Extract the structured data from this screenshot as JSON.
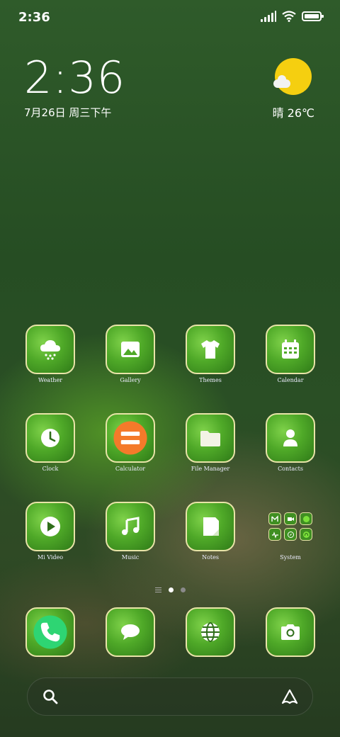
{
  "status_bar": {
    "time": "2:36",
    "icons": [
      "signal-icon",
      "wifi-icon",
      "battery-icon"
    ]
  },
  "clock_widget": {
    "time": "2:36",
    "date": "7月26日 周三下午"
  },
  "weather_widget": {
    "condition_icon": "sun-cloud-icon",
    "text": "晴 26℃"
  },
  "apps": {
    "weather": "Weather",
    "gallery": "Gallery",
    "themes": "Themes",
    "calendar": "Calendar",
    "clock": "Clock",
    "calculator": "Calculator",
    "file_manager": "File Manager",
    "contacts": "Contacts",
    "mi_video": "Mi Video",
    "music": "Music",
    "notes": "Notes",
    "system": "System"
  },
  "dock": [
    "phone-icon",
    "messages-icon",
    "browser-icon",
    "camera-icon"
  ],
  "page_indicator": {
    "pages": 2,
    "active": 1
  },
  "search_bar": {
    "left_icon": "search-icon",
    "right_icon": "assistant-icon"
  },
  "colors": {
    "tile_border": "#e8e4a8",
    "calculator_accent": "#f47a2a",
    "phone_accent": "#2ed573"
  }
}
